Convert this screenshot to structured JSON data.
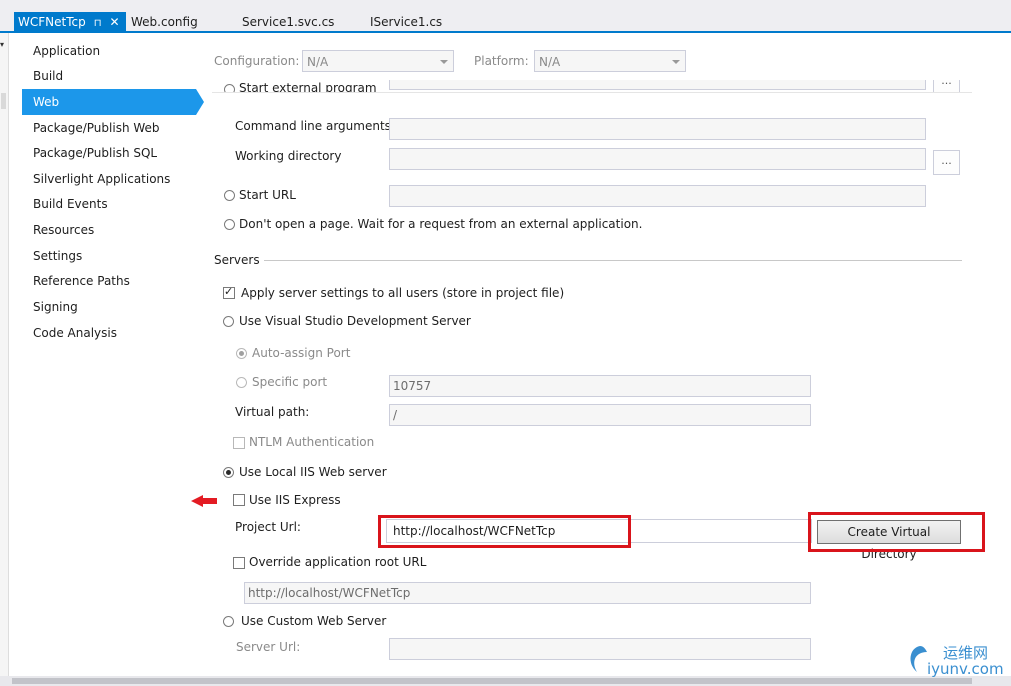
{
  "tabs": {
    "active": "WCFNetTcp",
    "pin_icon": "⊓",
    "close_icon": "✕",
    "others": [
      "Web.config",
      "Service1.svc.cs",
      "IService1.cs"
    ]
  },
  "sidebar": {
    "items": [
      "Application",
      "Build",
      "Web",
      "Package/Publish Web",
      "Package/Publish SQL",
      "Silverlight Applications",
      "Build Events",
      "Resources",
      "Settings",
      "Reference Paths",
      "Signing",
      "Code Analysis"
    ],
    "selected": "Web"
  },
  "config": {
    "configuration_label": "Configuration:",
    "configuration_value": "N/A",
    "platform_label": "Platform:",
    "platform_value": "N/A"
  },
  "start_action": {
    "start_external_program": "Start external program",
    "command_line_args": "Command line arguments",
    "working_directory": "Working directory",
    "browse_label": "...",
    "start_url": "Start URL",
    "dont_open": "Don't open a page.  Wait for a request from an external application."
  },
  "servers": {
    "heading": "Servers",
    "apply_all": "Apply server settings to all users (store in project file)",
    "use_vs_dev": "Use Visual Studio Development Server",
    "auto_assign": "Auto-assign Port",
    "specific_port": "Specific port",
    "port_value": "10757",
    "virtual_path_label": "Virtual path:",
    "virtual_path_value": "/",
    "ntlm": "NTLM Authentication",
    "use_local_iis": "Use Local IIS Web server",
    "use_iis_express": "Use IIS Express",
    "project_url_label": "Project Url:",
    "project_url_value": "http://localhost/WCFNetTcp",
    "create_vdir": "Create Virtual Directory",
    "override_root": "Override application root URL",
    "override_root_value": "http://localhost/WCFNetTcp",
    "use_custom": "Use Custom Web Server",
    "server_url_label": "Server Url:"
  },
  "watermark": {
    "line1": "运维网",
    "line2": "iyunv.com"
  },
  "colors": {
    "accent": "#007acc",
    "selection": "#1c97ea",
    "highlight_red": "#d9141b"
  }
}
